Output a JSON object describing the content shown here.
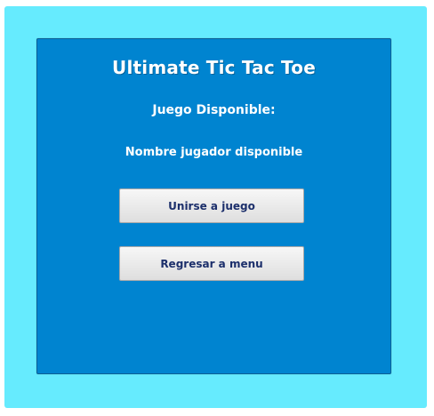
{
  "title": "Ultimate Tic Tac Toe",
  "subtitle": "Juego Disponible:",
  "player_name": "Nombre jugador disponible",
  "buttons": {
    "join_label": "Unirse a juego",
    "back_label": "Regresar a menu"
  },
  "colors": {
    "outer_background": "#66ebfe",
    "panel_background": "#0084d0",
    "text": "#ffffff",
    "button_text": "#1c2f6b"
  }
}
